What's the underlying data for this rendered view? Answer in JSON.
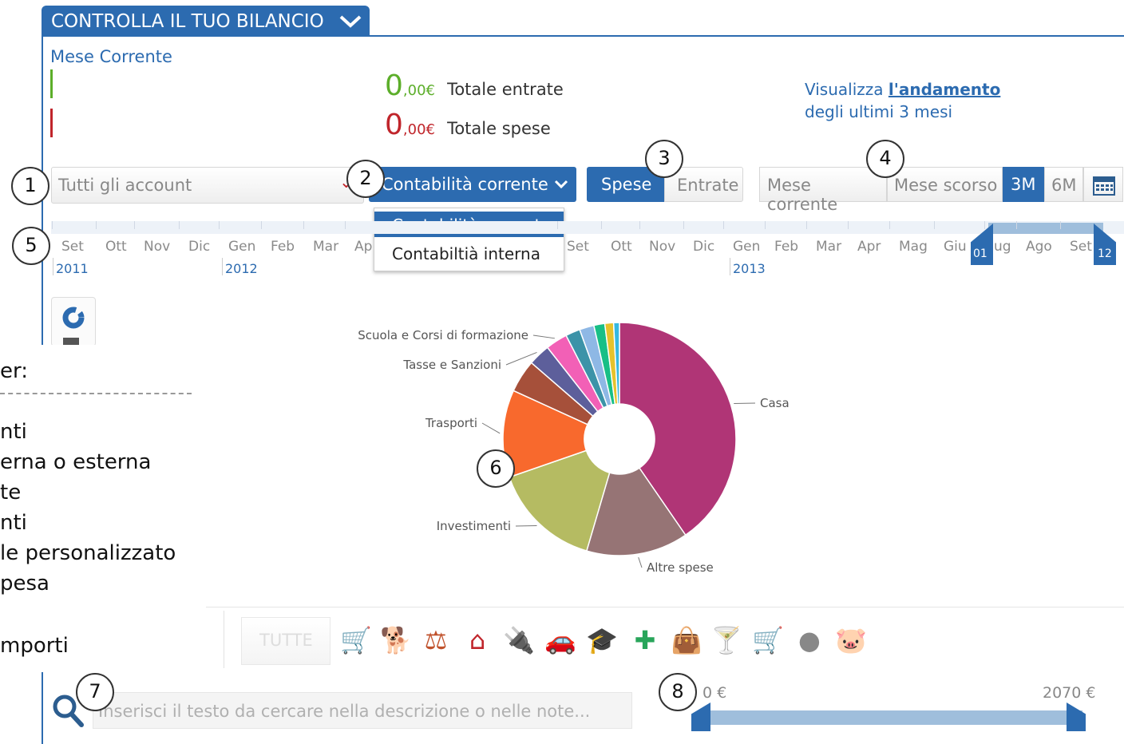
{
  "header": {
    "tab_title": "CONTROLLA IL TUO BILANCIO",
    "period_title": "Mese Corrente"
  },
  "totals": {
    "income_int": "0",
    "income_dec": ",00€",
    "income_label": "Totale entrate",
    "expense_int": "0",
    "expense_dec": ",00€",
    "expense_label": "Totale spese"
  },
  "trend": {
    "prefix": "Visualizza",
    "link": "l'andamento",
    "line2": "degli ultimi 3 mesi"
  },
  "filters": {
    "account_placeholder": "Tutti gli account",
    "accounting_selected": "Contabilità corrente",
    "accounting_options": [
      "Contabilità corrente",
      "Contabiltià interna"
    ],
    "type_spese": "Spese",
    "type_entrate": "Entrate",
    "period_current": "Mese corrente",
    "period_last": "Mese scorso",
    "period_3m": "3M",
    "period_6m": "6M"
  },
  "timeline": {
    "months_2011": [
      "Set",
      "Ott",
      "Nov",
      "Dic"
    ],
    "months_2012": [
      "Gen",
      "Feb",
      "Mar",
      "Ap",
      "Set",
      "Ott",
      "Nov",
      "Dic"
    ],
    "months_2013": [
      "Gen",
      "Feb",
      "Mar",
      "Apr",
      "Mag",
      "Giu",
      "ug",
      "Ago",
      "Set"
    ],
    "years": [
      "2011",
      "2012",
      "2013"
    ],
    "handle_start": "01",
    "handle_end": "12"
  },
  "legend_fragments": [
    "er:",
    "nti",
    "erna o esterna",
    "te",
    "nti",
    "le personalizzato",
    "pesa",
    "mporti"
  ],
  "chart_data": {
    "type": "pie",
    "donut": true,
    "labels": [
      "Casa",
      "Altre spese",
      "Investimenti",
      "Trasporti",
      "Tasse e Sanzioni",
      "Scuola e Corsi di formazione"
    ],
    "slices": [
      {
        "name": "Casa",
        "value": 40,
        "color": "#b03576"
      },
      {
        "name": "Altre spese",
        "value": 14,
        "color": "#967475"
      },
      {
        "name": "Investimenti",
        "value": 15,
        "color": "#b5bb62"
      },
      {
        "name": "Trasporti",
        "value": 12,
        "color": "#f8692d"
      },
      {
        "name": "",
        "value": 4.5,
        "color": "#a6503a"
      },
      {
        "name": "Tasse e Sanzioni",
        "value": 3,
        "color": "#5d5f9b"
      },
      {
        "name": "Scuola e Corsi di formazione",
        "value": 3,
        "color": "#f260b6"
      },
      {
        "name": "",
        "value": 2,
        "color": "#3c93a8"
      },
      {
        "name": "",
        "value": 2,
        "color": "#8eb8e5"
      },
      {
        "name": "",
        "value": 1.5,
        "color": "#18bf86"
      },
      {
        "name": "",
        "value": 1.2,
        "color": "#e6c22c"
      },
      {
        "name": "",
        "value": 0.8,
        "color": "#36b8e0"
      }
    ]
  },
  "categories": {
    "all_label": "TUTTE",
    "icons": [
      {
        "name": "stroller-icon",
        "glyph": "🛒",
        "color": "#2aa59b"
      },
      {
        "name": "pet-icon",
        "glyph": "🐕",
        "color": "#8b7b3a"
      },
      {
        "name": "balance-scale-icon",
        "glyph": "⚖",
        "color": "#c0512b"
      },
      {
        "name": "home-icon",
        "glyph": "⌂",
        "color": "#c0252b"
      },
      {
        "name": "plug-icon",
        "glyph": "🔌",
        "color": "#c23b8b"
      },
      {
        "name": "car-icon",
        "glyph": "🚗",
        "color": "#e06030"
      },
      {
        "name": "graduation-cap-icon",
        "glyph": "🎓",
        "color": "#3d5c8c"
      },
      {
        "name": "health-cross-icon",
        "glyph": "✚",
        "color": "#28a55a"
      },
      {
        "name": "shopping-bag-icon",
        "glyph": "👜",
        "color": "#2aa59b"
      },
      {
        "name": "cocktail-icon",
        "glyph": "🍸",
        "color": "#4fb3d9"
      },
      {
        "name": "cart-icon",
        "glyph": "🛒",
        "color": "#e6a520"
      },
      {
        "name": "coins-icon",
        "glyph": "●",
        "color": "#888888"
      },
      {
        "name": "piggy-bank-icon",
        "glyph": "🐷",
        "color": "#8bb540"
      }
    ]
  },
  "search": {
    "placeholder": "Inserisci il testo da cercare nella descrizione o nelle note..."
  },
  "amount_range": {
    "min_label": "0 €",
    "max_label": "2070 €"
  },
  "markers": [
    "1",
    "2",
    "3",
    "4",
    "5",
    "6",
    "7",
    "8"
  ]
}
